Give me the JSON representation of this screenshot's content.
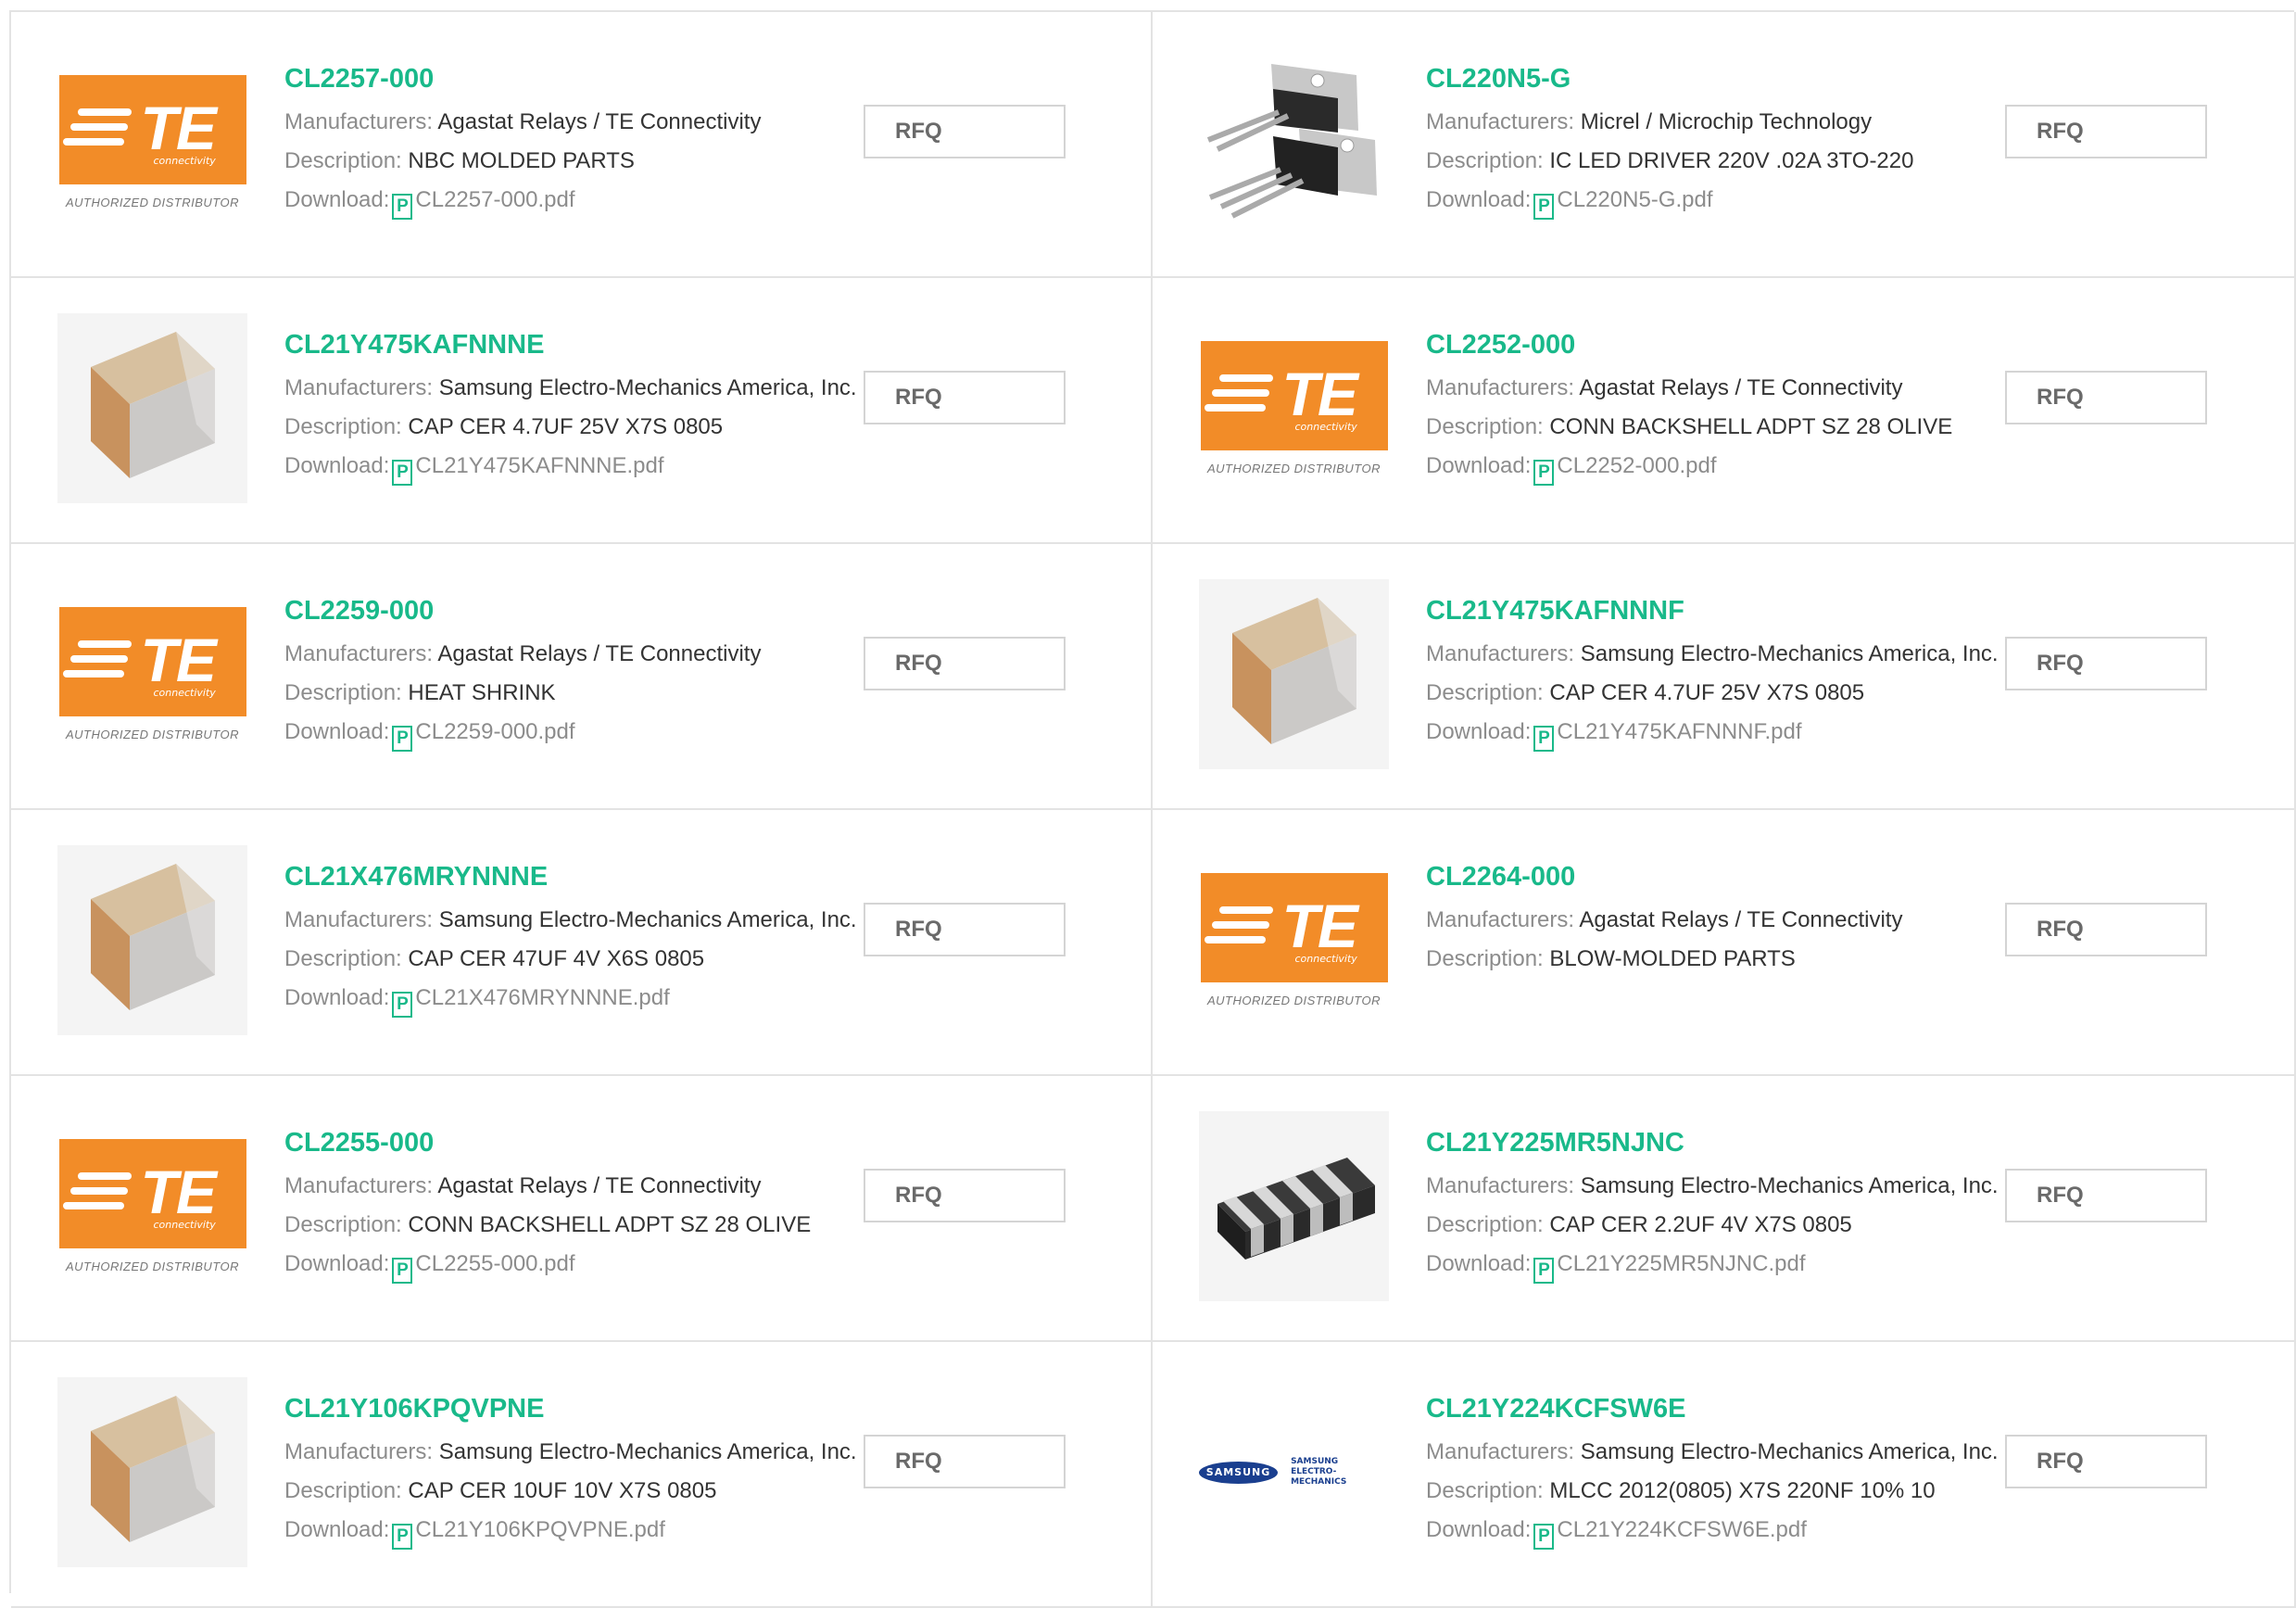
{
  "labels": {
    "manufacturers": "Manufacturers:",
    "description": "Description:",
    "download": "Download:",
    "rfq": "RFQ",
    "pdf_glyph": "P"
  },
  "logos": {
    "te_text": "TE",
    "te_sub": "connectivity",
    "te_caption": "AUTHORIZED DISTRIBUTOR",
    "samsung_oval": "SAMSUNG",
    "samsung_line1": "SAMSUNG",
    "samsung_line2": "ELECTRO-MECHANICS"
  },
  "colors": {
    "accent_green": "#19b98a",
    "te_orange": "#f28c28",
    "samsung_blue": "#1a3f8f",
    "grid_line": "#e3e3e3"
  },
  "products": [
    {
      "part": "CL2257-000",
      "manufacturer": "Agastat Relays / TE Connectivity",
      "description": "NBC MOLDED PARTS",
      "file": "CL2257-000.pdf",
      "image": "te-logo"
    },
    {
      "part": "CL220N5-G",
      "manufacturer": "Micrel / Microchip Technology",
      "description": "IC LED DRIVER 220V .02A 3TO-220",
      "file": "CL220N5-G.pdf",
      "image": "to220-package"
    },
    {
      "part": "CL21Y475KAFNNNE",
      "manufacturer": "Samsung Electro-Mechanics America, Inc.",
      "description": "CAP CER 4.7UF 25V X7S 0805",
      "file": "CL21Y475KAFNNNE.pdf",
      "image": "mlcc-chip"
    },
    {
      "part": "CL2252-000",
      "manufacturer": "Agastat Relays / TE Connectivity",
      "description": "CONN BACKSHELL ADPT SZ 28 OLIVE",
      "file": "CL2252-000.pdf",
      "image": "te-logo"
    },
    {
      "part": "CL2259-000",
      "manufacturer": "Agastat Relays / TE Connectivity",
      "description": "HEAT SHRINK",
      "file": "CL2259-000.pdf",
      "image": "te-logo"
    },
    {
      "part": "CL21Y475KAFNNNF",
      "manufacturer": "Samsung Electro-Mechanics America, Inc.",
      "description": "CAP CER 4.7UF 25V X7S 0805",
      "file": "CL21Y475KAFNNNF.pdf",
      "image": "mlcc-chip"
    },
    {
      "part": "CL21X476MRYNNNE",
      "manufacturer": "Samsung Electro-Mechanics America, Inc.",
      "description": "CAP CER 47UF 4V X6S 0805",
      "file": "CL21X476MRYNNNE.pdf",
      "image": "mlcc-chip"
    },
    {
      "part": "CL2264-000",
      "manufacturer": "Agastat Relays / TE Connectivity",
      "description": "BLOW-MOLDED PARTS",
      "file": null,
      "image": "te-logo"
    },
    {
      "part": "CL2255-000",
      "manufacturer": "Agastat Relays / TE Connectivity",
      "description": "CONN BACKSHELL ADPT SZ 28 OLIVE",
      "file": "CL2255-000.pdf",
      "image": "te-logo"
    },
    {
      "part": "CL21Y225MR5NJNC",
      "manufacturer": "Samsung Electro-Mechanics America, Inc.",
      "description": "CAP CER 2.2UF 4V X7S 0805",
      "file": "CL21Y225MR5NJNC.pdf",
      "image": "capacitor-array"
    },
    {
      "part": "CL21Y106KPQVPNE",
      "manufacturer": "Samsung Electro-Mechanics America, Inc.",
      "description": "CAP CER 10UF 10V X7S 0805",
      "file": "CL21Y106KPQVPNE.pdf",
      "image": "mlcc-chip"
    },
    {
      "part": "CL21Y224KCFSW6E",
      "manufacturer": "Samsung Electro-Mechanics America, Inc.",
      "description": "MLCC 2012(0805) X7S 220NF 10% 10",
      "file": "CL21Y224KCFSW6E.pdf",
      "image": "samsung-logo"
    }
  ]
}
